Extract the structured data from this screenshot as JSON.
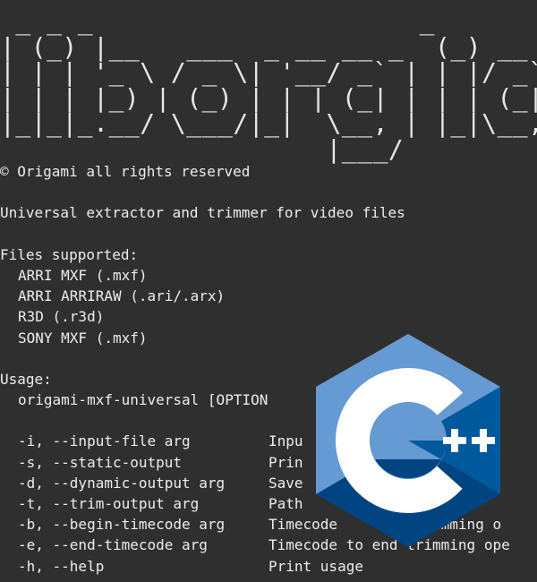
{
  "banner": {
    "ascii_art": " _ _ _                     _   \n| (_) |__   ___  _ __ __ _  (_) __ _ _ __ ___  (_)\n| | | '_ \\ / _ \\| '__/ _` | | |/ _` | '_ ` _ \\ | |\n| | | |_) | (_) | | | (_| | | | (_| | | | | | || |\n|_|_|_.__/ \\___/|_|  \\__, | |_|\\__,_|_| |_| |_||_|\n                     |___/                        ",
    "text": "liborigami"
  },
  "copyright": "© Origami all rights reserved",
  "description": "Universal extractor and trimmer for video files",
  "files": {
    "heading": "Files supported:",
    "items": [
      "ARRI MXF (.mxf)",
      "ARRI ARRIRAW (.ari/.arx)",
      "R3D (.r3d)",
      "SONY MXF (.mxf)"
    ]
  },
  "usage": {
    "heading": "Usage:",
    "command": "origami-mxf-universal [OPTION",
    "options": [
      {
        "flag": "-i, --input-file arg",
        "desc": "Inpu"
      },
      {
        "flag": "-s, --static-output",
        "desc": "Prin                o std"
      },
      {
        "flag": "-d, --dynamic-output arg",
        "desc": "Save                into a"
      },
      {
        "flag": "-t, --trim-output arg",
        "desc": "Path                 ile"
      },
      {
        "flag": "-b, --begin-timecode arg",
        "desc": "Timecode         trimming o"
      },
      {
        "flag": "-e, --end-timecode arg",
        "desc": "Timecode to end trimming ope"
      },
      {
        "flag": "-h, --help",
        "desc": "Print usage"
      }
    ]
  },
  "logo": {
    "icon": "cplusplus-logo-icon",
    "letter": "C",
    "plus_text": "++",
    "colors": {
      "light": "#659ad2",
      "mid": "#00599c",
      "dark": "#004482",
      "white": "#ffffff"
    }
  },
  "colors": {
    "background": "#2f2f2f",
    "text": "#ececec"
  }
}
